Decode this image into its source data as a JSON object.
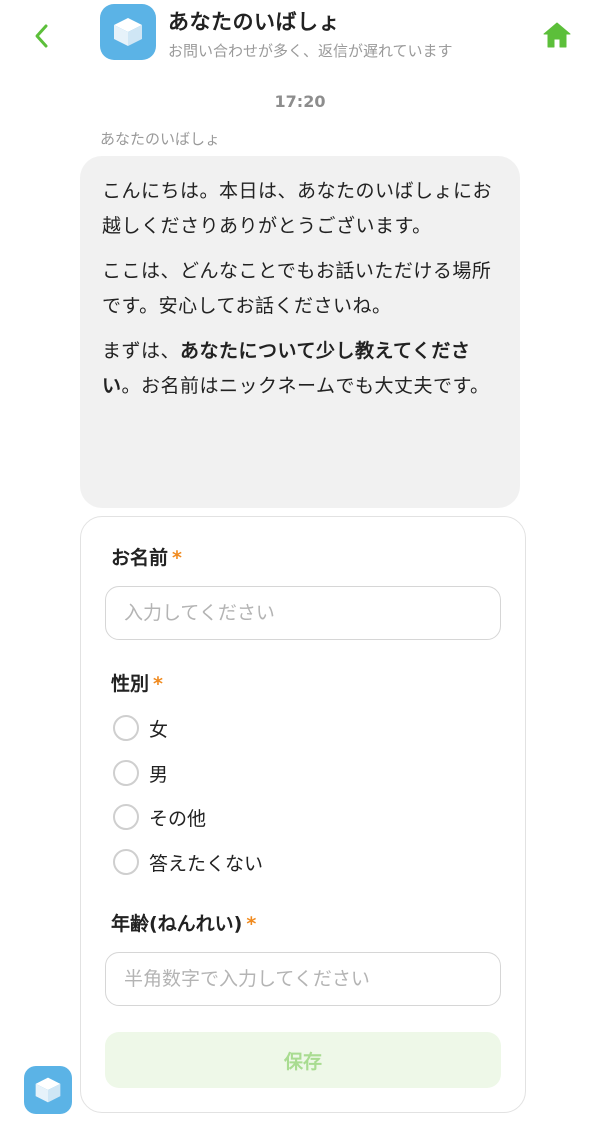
{
  "header": {
    "back_icon": "chevron-left-icon",
    "avatar_icon": "cube-icon",
    "title": "あなたのいばしょ",
    "subtitle": "お問い合わせが多く、返信が遅れています",
    "home_icon": "home-icon"
  },
  "chat": {
    "time": "17:20",
    "sender": "あなたのいばしょ",
    "message": {
      "p1": "こんにちは。本日は、あなたのいばしょにお越しくださりありがとうございます。",
      "p2": "ここは、どんなことでもお話いただける場所です。安心してお話くださいね。",
      "p3_prefix": "まずは、",
      "p3_bold": "あなたについて少し教えてください",
      "p3_suffix": "。お名前はニックネームでも大丈夫です。"
    }
  },
  "form": {
    "name": {
      "label": "お名前",
      "required_mark": "*",
      "placeholder": "入力してください",
      "value": ""
    },
    "gender": {
      "label": "性別",
      "required_mark": "*",
      "options": [
        "女",
        "男",
        "その他",
        "答えたくない"
      ],
      "selected": null
    },
    "age": {
      "label": "年齢(ねんれい)",
      "required_mark": "*",
      "placeholder": "半角数字で入力してください",
      "value": ""
    },
    "save_label": "保存"
  },
  "colors": {
    "accent_green": "#5cbf3a",
    "avatar_blue": "#5bb3e6",
    "required_orange": "#f08a1e",
    "bubble_gray": "#f1f1f1",
    "save_bg": "#eef8e8",
    "save_text": "#a9dc91"
  },
  "footer": {
    "avatar_icon": "cube-icon"
  }
}
